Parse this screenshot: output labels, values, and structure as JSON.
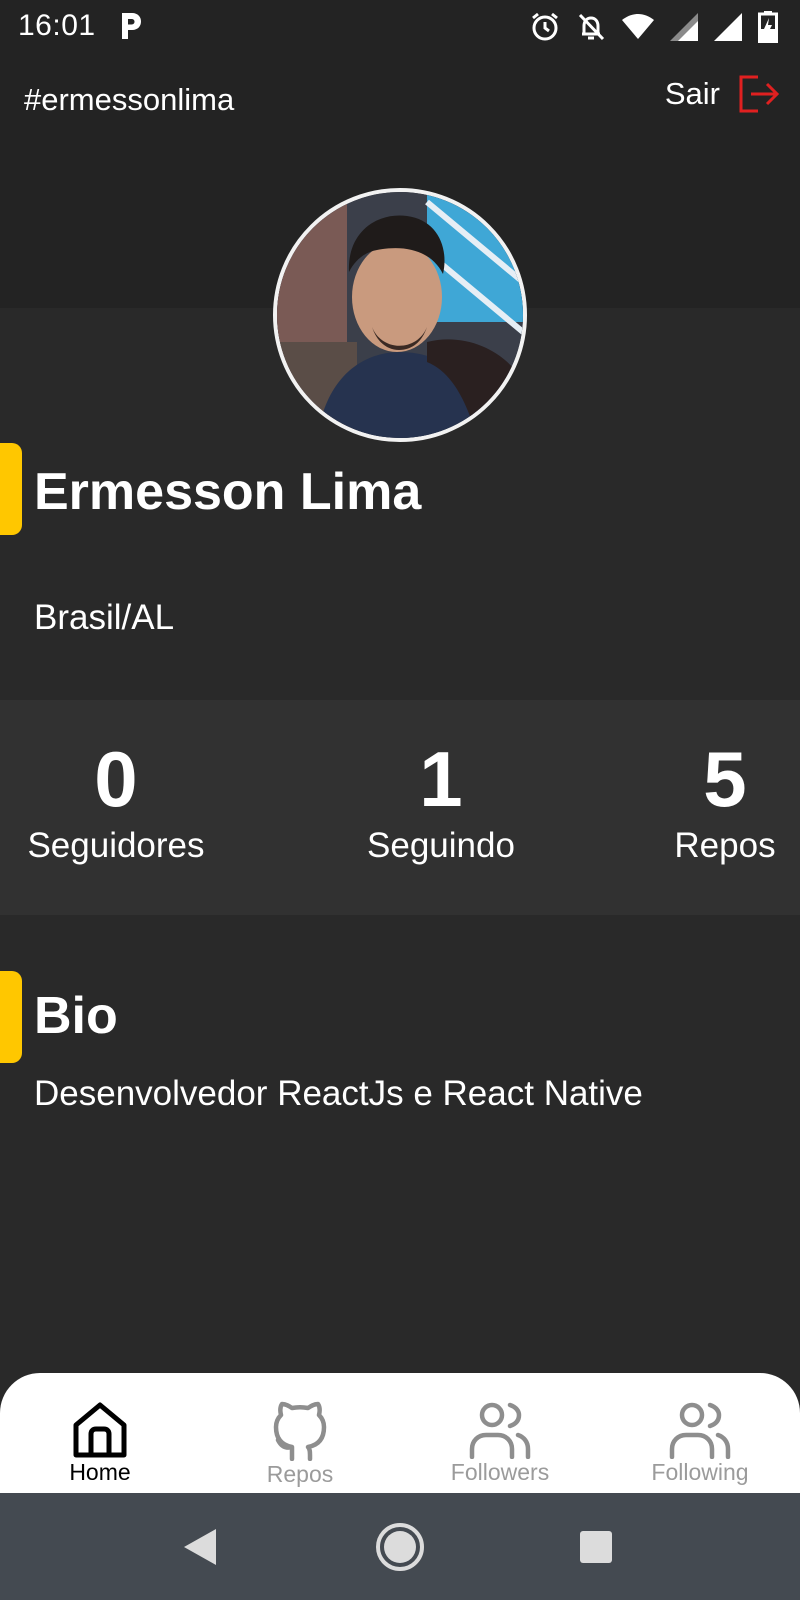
{
  "status_bar": {
    "time": "16:01",
    "icons": [
      "p-app-icon",
      "alarm-icon",
      "notifications-off-icon",
      "wifi-icon",
      "signal-icon",
      "signal-icon",
      "battery-charging-icon"
    ]
  },
  "header": {
    "handle": "#ermessonlima",
    "logout_label": "Sair",
    "logout_icon": "logout-icon",
    "logout_color": "#E02020"
  },
  "profile": {
    "avatar": "user-avatar-photo",
    "name": "Ermesson Lima",
    "location": "Brasil/AL",
    "accent_color": "#FFC700"
  },
  "stats": [
    {
      "value": "0",
      "label": "Seguidores"
    },
    {
      "value": "1",
      "label": "Seguindo"
    },
    {
      "value": "5",
      "label": "Repos"
    }
  ],
  "bio": {
    "title": "Bio",
    "text": "Desenvolvedor ReactJs e React Native"
  },
  "tabs": [
    {
      "label": "Home",
      "icon": "home-icon",
      "active": true
    },
    {
      "label": "Repos",
      "icon": "github-icon",
      "active": false
    },
    {
      "label": "Followers",
      "icon": "users-icon",
      "active": false
    },
    {
      "label": "Following",
      "icon": "users-icon",
      "active": false
    }
  ],
  "nav": [
    "back-icon",
    "home-circle-icon",
    "recents-icon"
  ]
}
